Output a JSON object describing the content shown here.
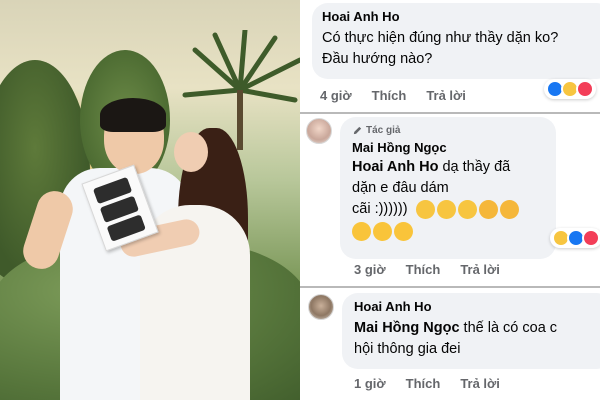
{
  "comments": [
    {
      "author": "Hoai Anh Ho",
      "text_line1": "Có thực hiện đúng như thầy dặn ko?",
      "text_line2": "Đầu hướng nào?",
      "time": "4 giờ",
      "like": "Thích",
      "reply": "Trả lời",
      "reactions": [
        "like-icon",
        "haha-icon",
        "love-icon"
      ]
    },
    {
      "badge": "Tác giả",
      "author": "Mai Hồng Ngọc",
      "mention": "Hoai Anh Ho",
      "text_line1_rest": " dạ thầy đã",
      "text_line2": "dặn e đâu dám",
      "text_line3": "cãi :))))))",
      "emojis_line3": [
        "star-struck-emoji",
        "star-struck-emoji",
        "star-struck-emoji",
        "smiling-hearts-emoji",
        "smiling-hearts-emoji"
      ],
      "emojis_line4": [
        "rofl-emoji",
        "rofl-emoji",
        "rofl-emoji"
      ],
      "time": "3 giờ",
      "like": "Thích",
      "reply": "Trả lời",
      "reactions": [
        "haha-icon",
        "like-icon",
        "love-icon"
      ]
    },
    {
      "author": "Hoai Anh Ho",
      "mention": "Mai Hồng Ngọc",
      "text_line1_rest": "  thế là có coa c",
      "text_line2": "hội thông gia đei",
      "time": "1 giờ",
      "like": "Thích",
      "reply": "Trả lời"
    }
  ],
  "colors": {
    "bubble": "#f0f2f5",
    "meta": "#65676b",
    "like": "#1877f2",
    "love": "#f33e58",
    "haha": "#f7c540"
  }
}
